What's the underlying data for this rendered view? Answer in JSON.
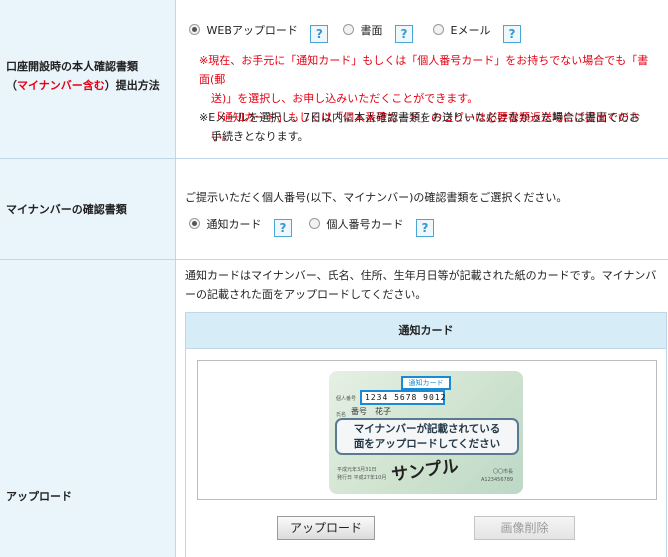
{
  "section1": {
    "heading_line1": "口座開設時の本人確認書類",
    "heading_paren_open": "（",
    "heading_red": "マイナンバー含む",
    "heading_paren_close": "）提出方法",
    "options": [
      {
        "label": "WEBアップロード",
        "selected": true
      },
      {
        "label": "書面",
        "selected": false
      },
      {
        "label": "Eメール",
        "selected": false
      }
    ],
    "help_glyph": "?",
    "note_red_1": "※現在、お手元に「通知カード」もしくは「個人番号カード」をお持ちでない場合でも「書面(郵",
    "note_red_2": "送)」を選択し、お申し込みいただくことができます。",
    "note_red_3": "「通知カード」もしくは「個人番号カード」のコピーは必要書類返送時にご提出ください。",
    "note_black_1": "※Eメールを選択し、7日以内に本人確認書類をお送りいただけなかった場合は書面でのお",
    "note_black_2": "手続きとなります。"
  },
  "section2": {
    "heading": "マイナンバーの確認書類",
    "instruction": "ご提示いただく個人番号(以下、マイナンバー)の確認書類をご選択ください。",
    "options": [
      {
        "label": "通知カード",
        "selected": true
      },
      {
        "label": "個人番号カード",
        "selected": false
      }
    ],
    "help_glyph": "?"
  },
  "section3": {
    "heading": "アップロード",
    "desc_1": "通知カードはマイナンバー、氏名、住所、生年月日等が記載された紙のカードです。マイナンバ",
    "desc_2": "ーの記載された面をアップロードしてください。",
    "panel_title": "通知カード",
    "card": {
      "top_label": "通知カード",
      "number_label": "個人番号",
      "number": "1234 5678 9012",
      "name_label": "氏名",
      "name": "番号　花子",
      "callout_1": "マイナンバーが記載されている",
      "callout_2": "面をアップロードしてください",
      "sample": "サンプル",
      "footer_left_1": "平成元年3月31日",
      "footer_left_2": "発行日 平成27年10月",
      "footer_right_1": "〇〇市長",
      "footer_right_2": "A123456789"
    },
    "upload_button": "アップロード",
    "delete_button": "画像削除"
  }
}
